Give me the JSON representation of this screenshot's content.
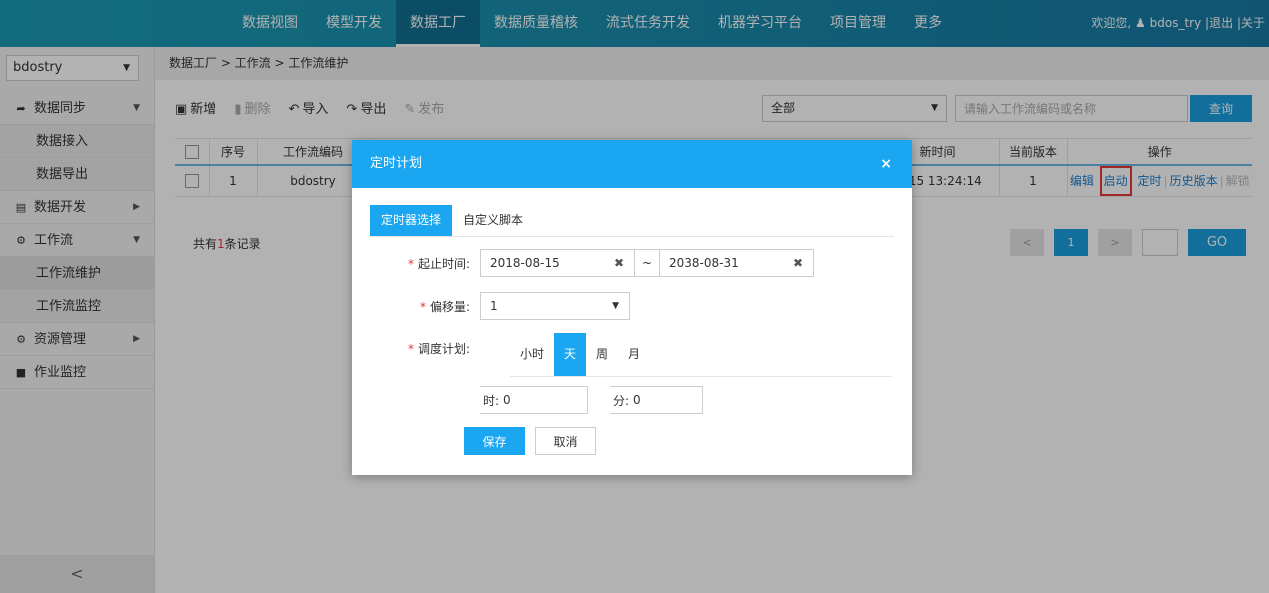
{
  "topnav": {
    "items": [
      "数据视图",
      "模型开发",
      "数据工厂",
      "数据质量稽核",
      "流式任务开发",
      "机器学习平台",
      "项目管理",
      "更多"
    ],
    "welcome": "欢迎您,",
    "username": "bdos_try",
    "logout": "退出",
    "sep": "|",
    "about": "关于"
  },
  "sidebar": {
    "project": "bdostry",
    "items": {
      "sync": "数据同步",
      "sync_in": "数据接入",
      "sync_out": "数据导出",
      "dev": "数据开发",
      "workflow": "工作流",
      "wf_maintain": "工作流维护",
      "wf_monitor": "工作流监控",
      "resource": "资源管理",
      "jobmon": "作业监控"
    },
    "collapse": "<"
  },
  "breadcrumb": "数据工厂 > 工作流 > 工作流维护",
  "toolbar": {
    "add": "新增",
    "delete": "删除",
    "import": "导入",
    "export": "导出",
    "publish": "发布"
  },
  "filter": {
    "value": "全部",
    "search_placeholder": "请输入工作流编码或名称",
    "search_button": "查询"
  },
  "table": {
    "headers": {
      "seq": "序号",
      "code": "工作流编码",
      "updated_partial": "新时间",
      "version": "当前版本",
      "ops": "操作"
    },
    "row": {
      "seq": "1",
      "code": "bdostry",
      "updated_partial": "-15 13:24:14",
      "version": "1",
      "ops": {
        "edit": "编辑",
        "start": "启动",
        "schedule": "定时",
        "history": "历史版本",
        "unlock": "解锁"
      }
    }
  },
  "records": {
    "prefix": "共有",
    "count": "1",
    "suffix": "条记录"
  },
  "pager": {
    "prev": "<",
    "current": "1",
    "next": ">",
    "go": "GO"
  },
  "modal": {
    "title": "定时计划",
    "close": "×",
    "tabs": [
      "定时器选择",
      "自定义脚本"
    ],
    "start_end_label": "起止时间:",
    "start_date": "2018-08-15",
    "tilde": "~",
    "end_date": "2038-08-31",
    "offset_label": "偏移量:",
    "offset_value": "1",
    "schedule_label": "调度计划:",
    "schedule_options": [
      "小时",
      "天",
      "周",
      "月"
    ],
    "schedule_selected": "天",
    "hour_label": "时:",
    "hour_value": "0",
    "minute_label": "分:",
    "minute_value": "0",
    "save": "保存",
    "cancel": "取消"
  },
  "colors": {
    "accent": "#1aa6f0",
    "nav": "#1a8fae",
    "danger": "#e53935"
  }
}
